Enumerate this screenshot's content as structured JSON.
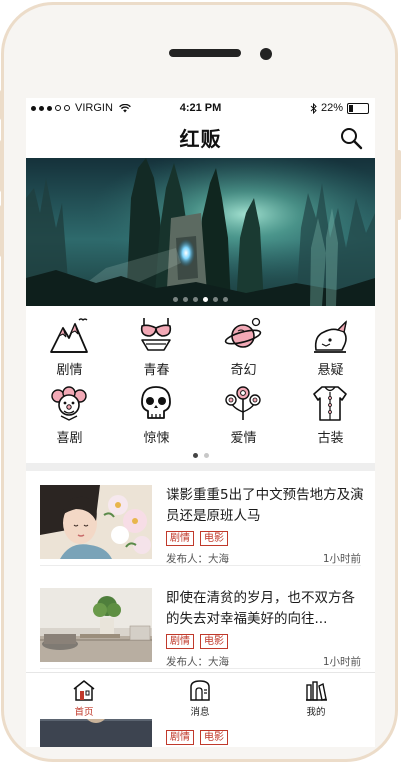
{
  "status_bar": {
    "carrier": "VIRGIN",
    "time": "4:21 PM",
    "battery": "22%"
  },
  "header": {
    "title": "红贩",
    "search_icon": "search-icon"
  },
  "banner": {
    "slide_count": 6,
    "active_slide": 4
  },
  "categories": [
    {
      "label": "剧情",
      "icon": "mountain-icon"
    },
    {
      "label": "青春",
      "icon": "bikini-icon"
    },
    {
      "label": "奇幻",
      "icon": "planet-icon"
    },
    {
      "label": "悬疑",
      "icon": "beast-icon"
    },
    {
      "label": "喜剧",
      "icon": "clown-icon"
    },
    {
      "label": "惊悚",
      "icon": "skull-icon"
    },
    {
      "label": "爱情",
      "icon": "flower-icon"
    },
    {
      "label": "古装",
      "icon": "robe-icon"
    }
  ],
  "category_pages": {
    "count": 2,
    "active": 1
  },
  "articles": [
    {
      "title": "谍影重重5出了中文预告地方及演员还是原班人马",
      "tags": [
        "剧情",
        "电影"
      ],
      "author": "发布人：大海",
      "time": "1小时前"
    },
    {
      "title": "即使在清贫的岁月，也不双方各的失去对幸福美好的向往...",
      "tags": [
        "剧情",
        "电影"
      ],
      "author": "发布人：大海",
      "time": "1小时前"
    },
    {
      "title": "",
      "tags": [
        "剧情",
        "电影"
      ],
      "author": "",
      "time": ""
    }
  ],
  "tab_bar": [
    {
      "label": "首页",
      "icon": "home-icon",
      "active": true
    },
    {
      "label": "消息",
      "icon": "message-icon",
      "active": false
    },
    {
      "label": "我的",
      "icon": "profile-icon",
      "active": false
    }
  ],
  "colors": {
    "accent": "#c0392b",
    "phone_frame": "#ecdcc9"
  }
}
